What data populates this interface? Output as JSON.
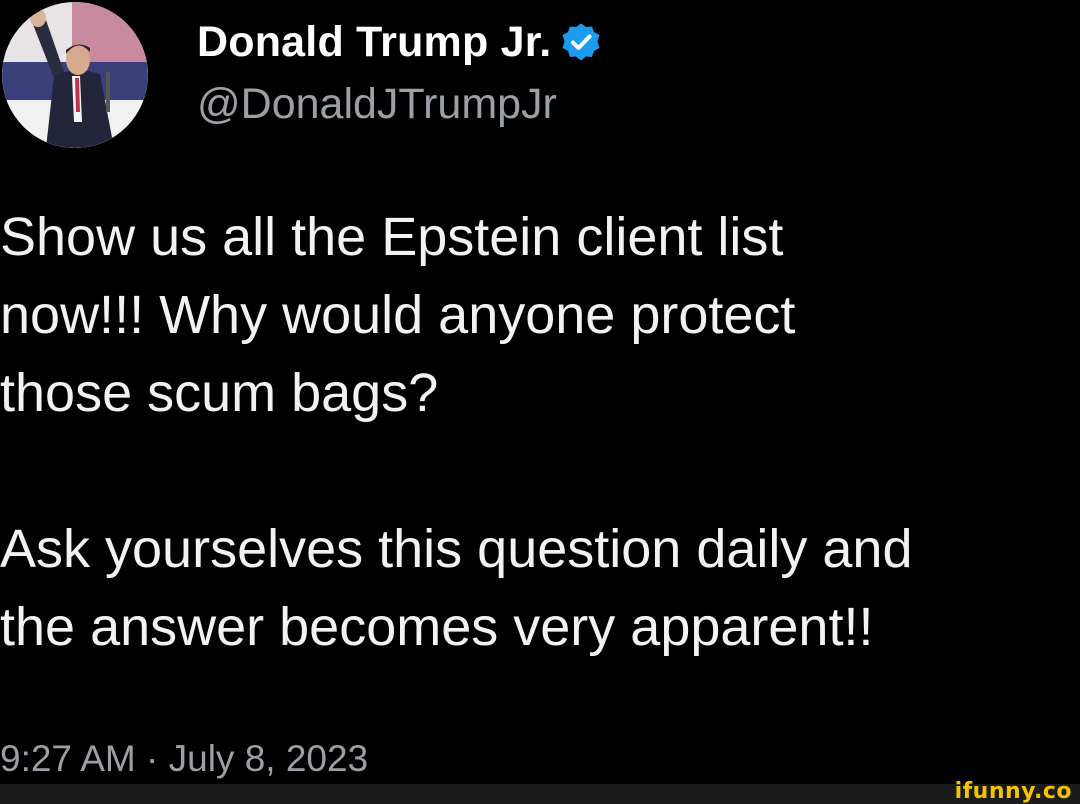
{
  "author": {
    "display_name": "Donald Trump Jr.",
    "handle": "@DonaldJTrumpJr",
    "verified": true,
    "verified_color": "#1d9bf0"
  },
  "tweet": {
    "paragraph_1_lines": [
      "Show us all the Epstein client list",
      "now!!! Why would anyone protect",
      "those scum bags?"
    ],
    "paragraph_2_lines": [
      "Ask yourselves this question daily and",
      "the answer becomes very apparent!!"
    ],
    "timestamp": "9:27 AM · July 8, 2023"
  },
  "watermark": {
    "text": "ifunny.co",
    "color": "#f4c400"
  },
  "icons": {
    "verified": "verified-badge-icon",
    "avatar": "profile-photo"
  }
}
